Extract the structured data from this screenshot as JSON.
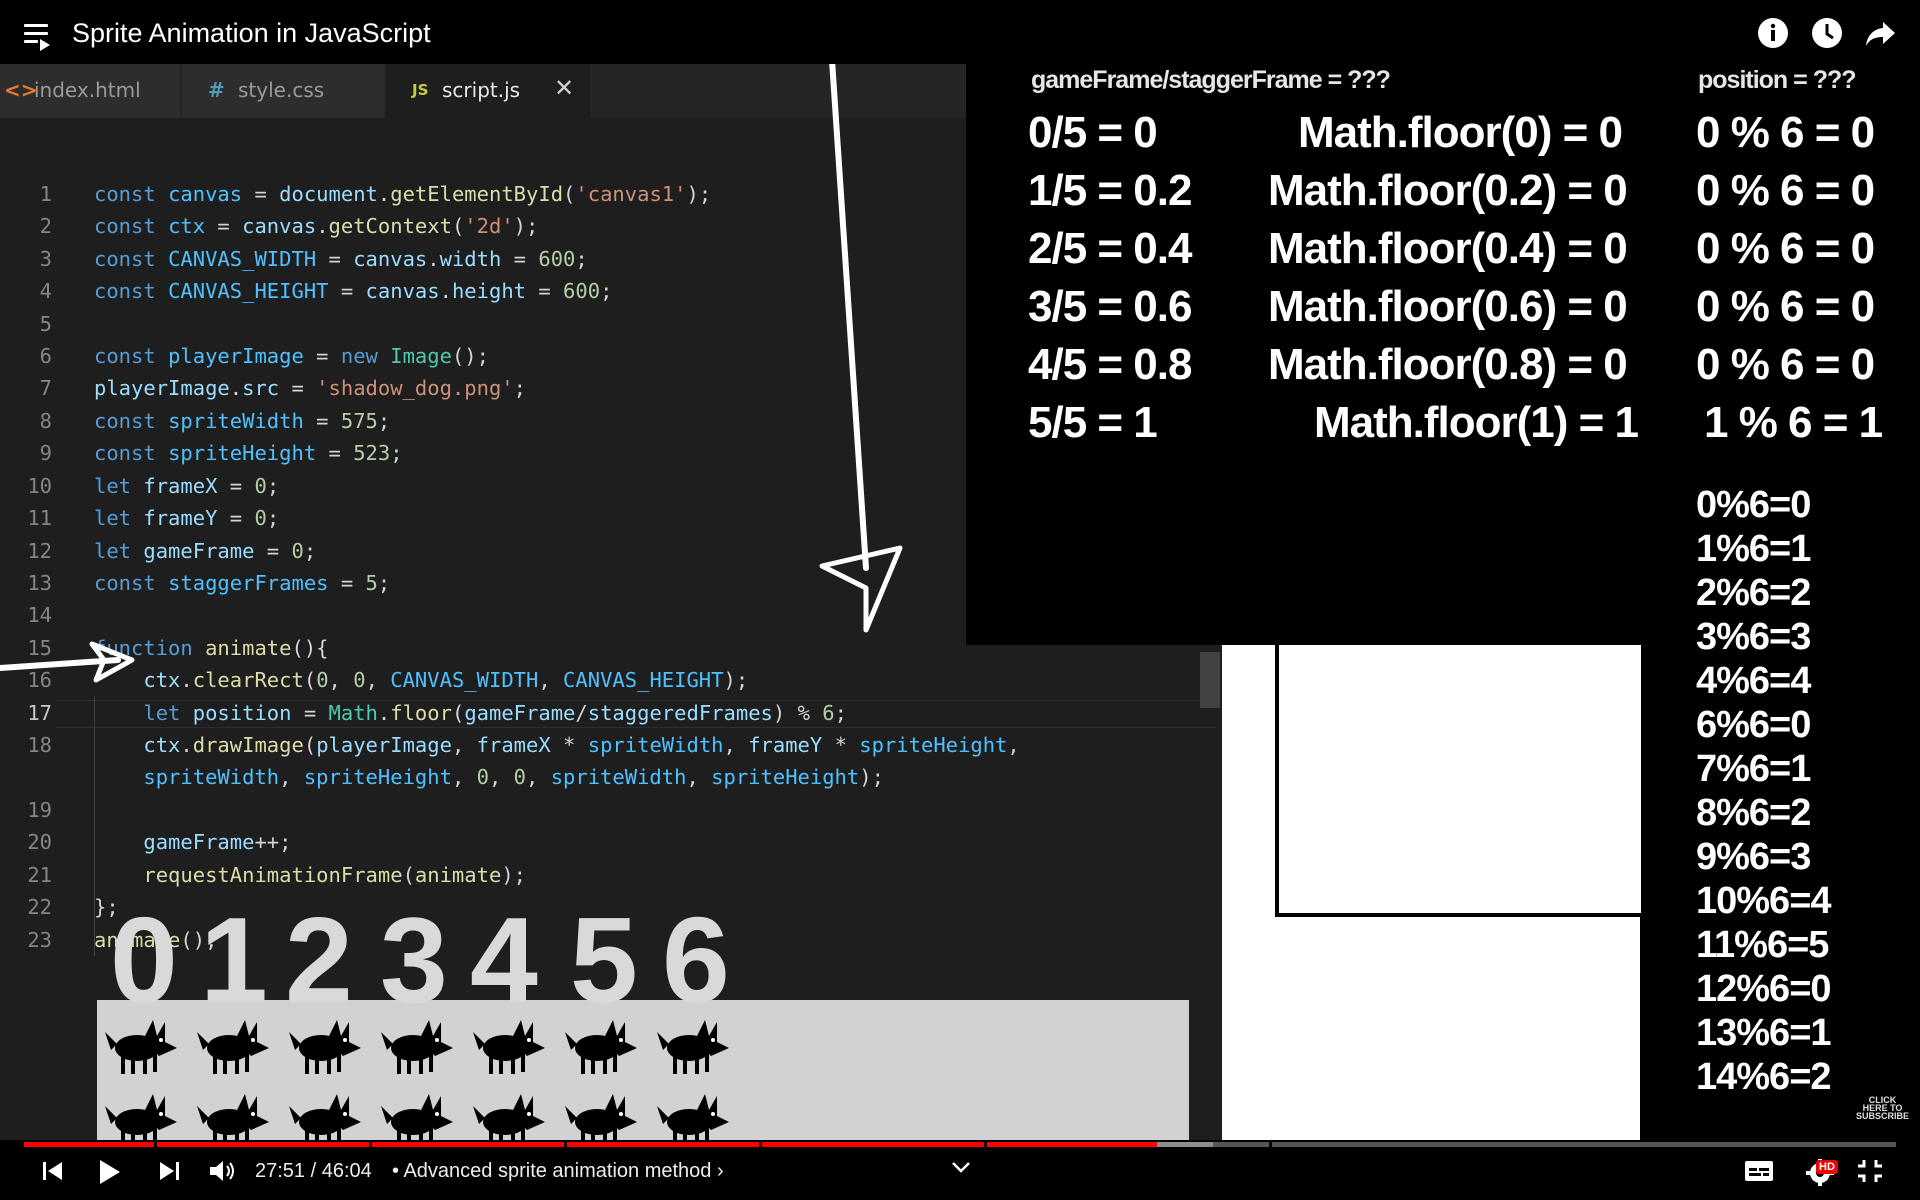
{
  "video": {
    "title": "Sprite Animation in JavaScript",
    "current_time": "27:51",
    "duration": "46:04",
    "time_display": "27:51 / 46:04",
    "chapter": "• Advanced sprite animation method",
    "chapter_arrow": "›",
    "progress_fraction": 0.605,
    "buffered_fraction": 0.635,
    "hd_badge": "HD",
    "subscribe_lines": [
      "CLICK",
      "HERE TO",
      "SUBSCRIBE"
    ],
    "icons": {
      "top": [
        "playlist-icon",
        "info-icon",
        "watch-later-icon",
        "share-icon"
      ],
      "controls": [
        "previous-icon",
        "play-icon",
        "next-icon",
        "volume-icon",
        "chevron-down-icon",
        "captions-icon",
        "settings-icon",
        "exit-fullscreen-icon"
      ]
    }
  },
  "editor": {
    "tabs": [
      {
        "icon": "<>",
        "label": "index.html",
        "icon_color": "#e37933",
        "active": false
      },
      {
        "icon": "#",
        "label": "style.css",
        "icon_color": "#519aba",
        "active": false
      },
      {
        "icon": "JS",
        "label": "script.js",
        "icon_color": "#cbcb41",
        "active": true,
        "close": "✕"
      }
    ],
    "line_numbers": [
      "1",
      "2",
      "3",
      "4",
      "5",
      "6",
      "7",
      "8",
      "9",
      "10",
      "11",
      "12",
      "13",
      "14",
      "15",
      "16",
      "17",
      "18",
      "",
      "19",
      "20",
      "21",
      "22",
      "23"
    ],
    "current_line": "17",
    "code_lines": [
      "const canvas = document.getElementById('canvas1');",
      "const ctx = canvas.getContext('2d');",
      "const CANVAS_WIDTH = canvas.width = 600;",
      "const CANVAS_HEIGHT = canvas.height = 600;",
      "",
      "const playerImage = new Image();",
      "playerImage.src = 'shadow_dog.png';",
      "const spriteWidth = 575;",
      "const spriteHeight = 523;",
      "let frameX = 0;",
      "let frameY = 0;",
      "let gameFrame = 0;",
      "const staggerFrames = 5;",
      "",
      "function animate(){",
      "    ctx.clearRect(0, 0, CANVAS_WIDTH, CANVAS_HEIGHT);",
      "    let position = Math.floor(gameFrame/staggeredFrames) % 6;",
      "    ctx.drawImage(playerImage, frameX * spriteWidth, frameY * spriteHeight,",
      "    spriteWidth, spriteHeight, 0, 0, spriteWidth, spriteHeight);",
      "",
      "    gameFrame++;",
      "    requestAnimationFrame(animate);",
      "};",
      "animate();"
    ]
  },
  "overlay": {
    "header_left": "gameFrame/staggerFrame = ???",
    "header_right": "position = ???",
    "division": [
      "0/5 = 0",
      "1/5 = 0.2",
      "2/5 = 0.4",
      "3/5 = 0.6",
      "4/5 = 0.8",
      "5/5 = 1"
    ],
    "floor": [
      "Math.floor(0) = 0",
      "Math.floor(0.2) = 0",
      "Math.floor(0.4) = 0",
      "Math.floor(0.6) = 0",
      "Math.floor(0.8) = 0",
      "Math.floor(1) = 1"
    ],
    "modulo": [
      "0 % 6 = 0",
      "0 % 6 = 0",
      "0 % 6 = 0",
      "0 % 6 = 0",
      "0 % 6 = 0",
      "1 % 6 = 1"
    ],
    "modulo_list": [
      "0%6=0",
      "1%6=1",
      "2%6=2",
      "3%6=3",
      "4%6=4",
      "6%6=0",
      "7%6=1",
      "8%6=2",
      "9%6=3",
      "10%6=4",
      "11%6=5",
      "12%6=0",
      "13%6=1",
      "14%6=2"
    ]
  },
  "sprite_frames": [
    "0",
    "1",
    "2",
    "3",
    "4",
    "5",
    "6"
  ]
}
